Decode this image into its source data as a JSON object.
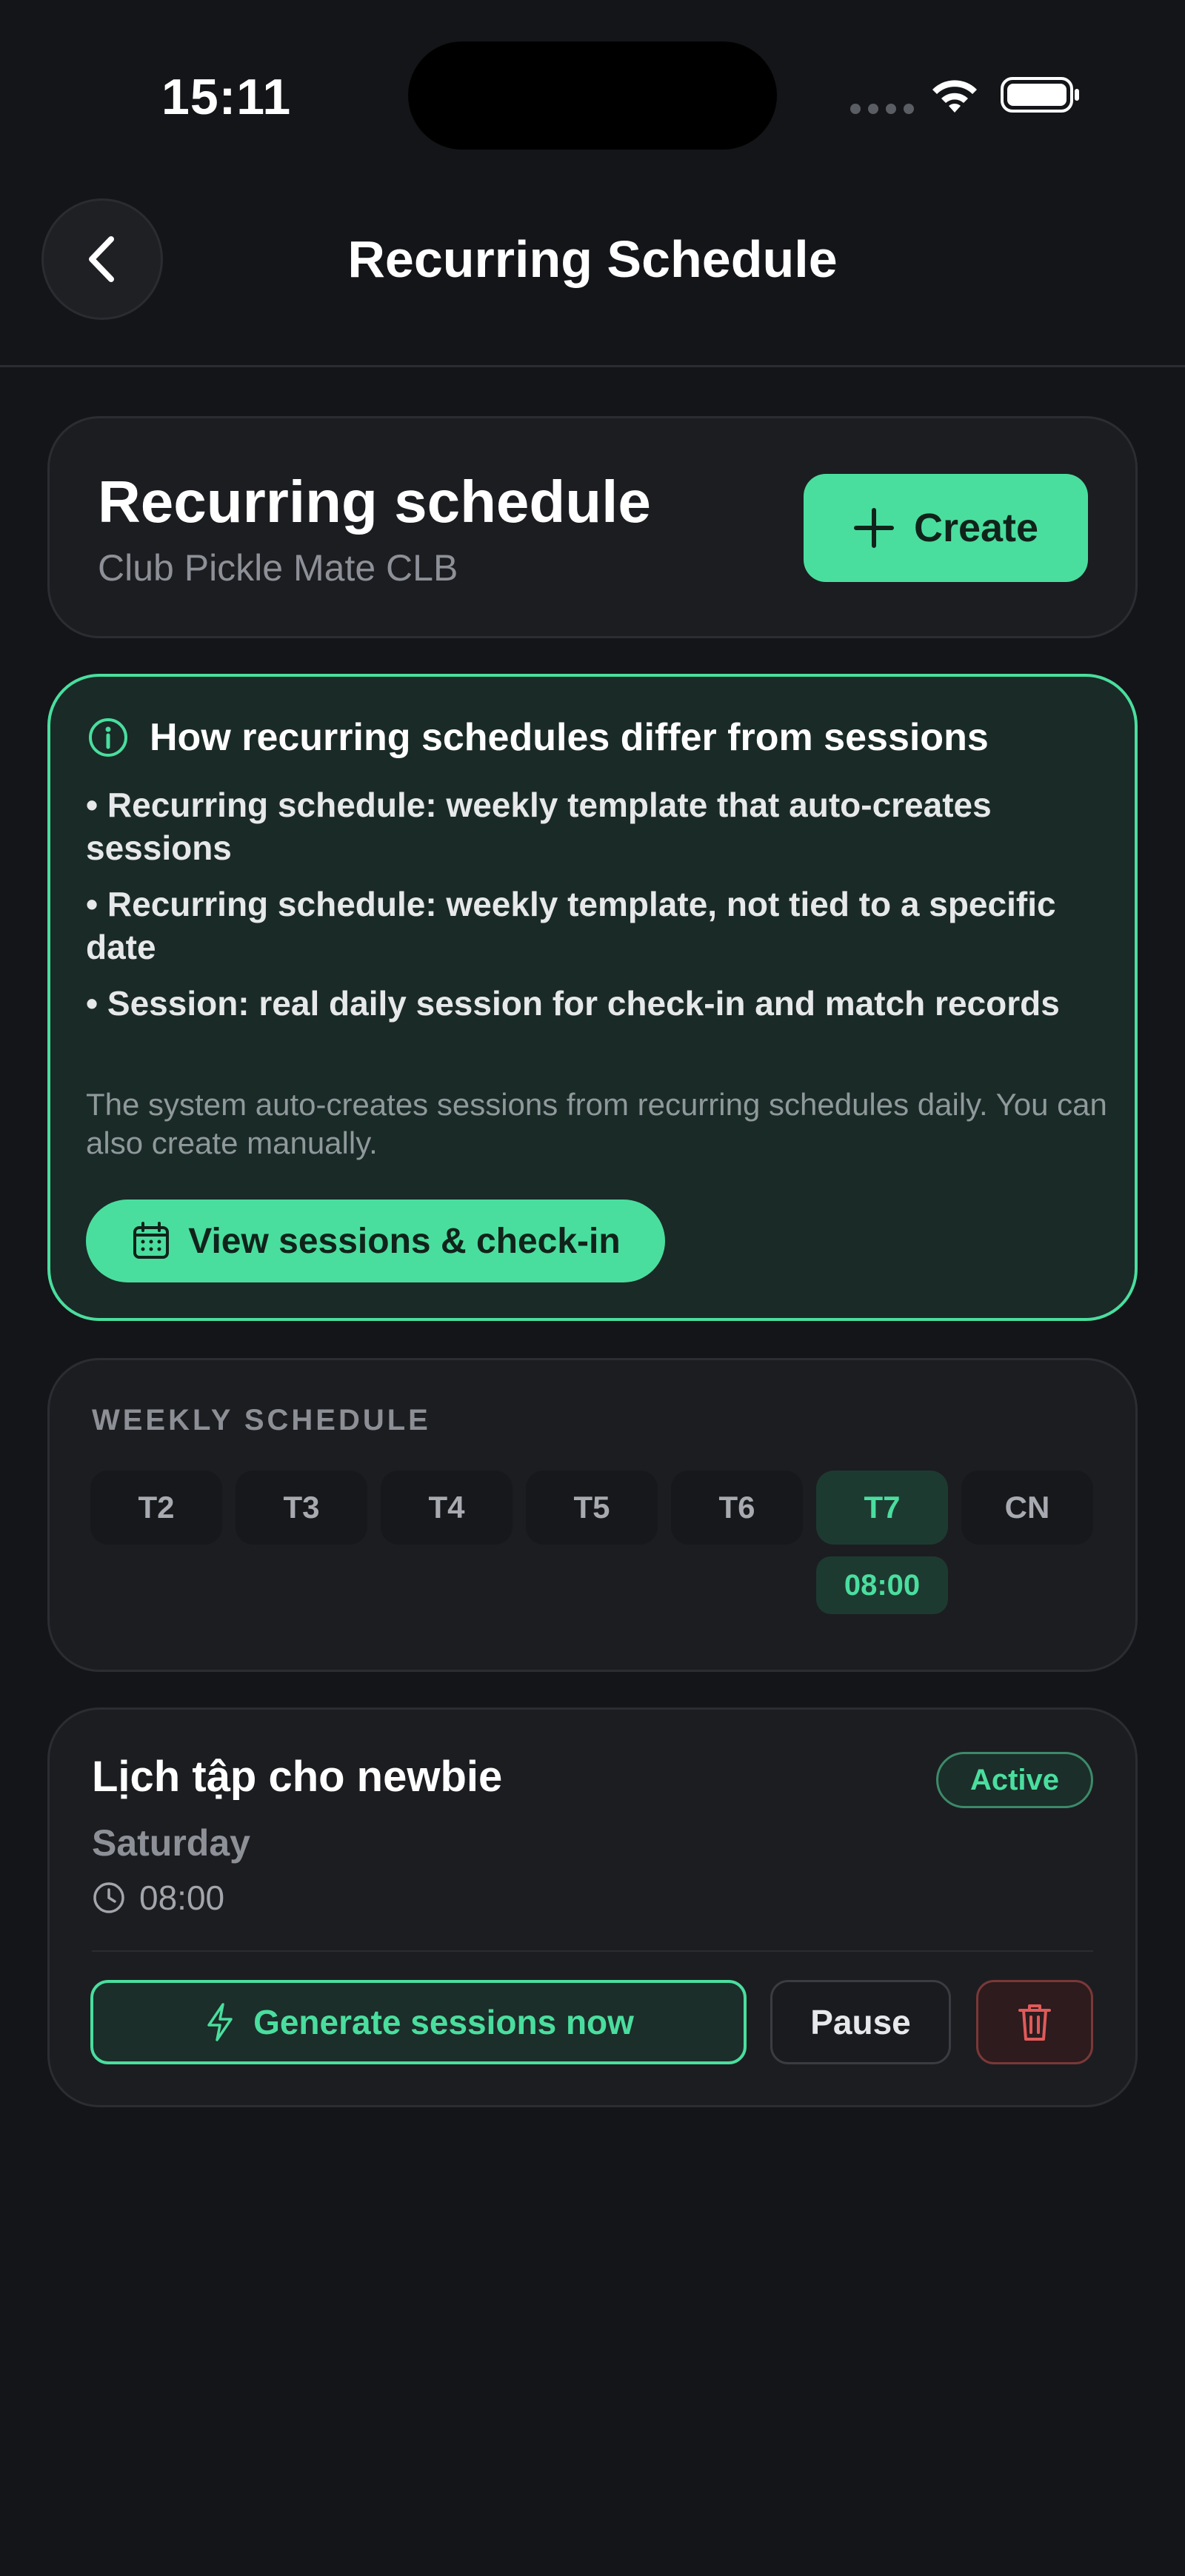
{
  "status_bar": {
    "time": "15:11"
  },
  "nav": {
    "title": "Recurring Schedule"
  },
  "header": {
    "title": "Recurring schedule",
    "subtitle": "Club Pickle Mate CLB",
    "create_label": "Create"
  },
  "info": {
    "title": "How recurring schedules differ from sessions",
    "bullets": [
      "• Recurring schedule: weekly template that auto-creates sessions",
      "• Recurring schedule: weekly template, not tied to a specific date",
      "• Session: real daily session for check-in and match records"
    ],
    "note": "The system auto-creates sessions from recurring schedules daily. You can also create manually.",
    "button_label": "View sessions & check-in"
  },
  "weekly": {
    "title": "WEEKLY SCHEDULE",
    "days": [
      "T2",
      "T3",
      "T4",
      "T5",
      "T6",
      "T7",
      "CN"
    ],
    "active_day": "T7",
    "active_time": "08:00"
  },
  "schedule_item": {
    "title": "Lịch tập cho newbie",
    "status": "Active",
    "day": "Saturday",
    "time": "08:00",
    "generate_label": "Generate sessions now",
    "pause_label": "Pause"
  },
  "colors": {
    "accent": "#4ade9e",
    "background": "#141518",
    "card": "#1c1d21",
    "danger": "#e05a5a"
  },
  "icons": [
    "back-chevron-icon",
    "plus-icon",
    "info-icon",
    "calendar-icon",
    "clock-icon",
    "lightning-icon",
    "trash-icon",
    "wifi-icon",
    "battery-icon"
  ]
}
